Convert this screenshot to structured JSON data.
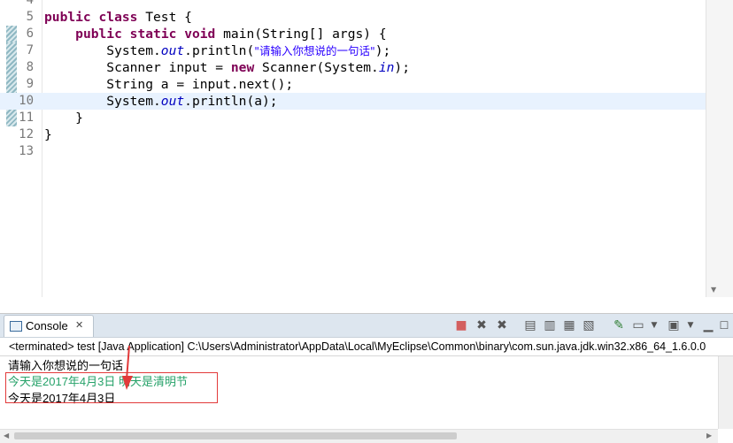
{
  "editor": {
    "lines": [
      {
        "num": "4",
        "segments": []
      },
      {
        "num": "5",
        "segments": [
          {
            "t": "kw",
            "v": "public"
          },
          {
            "t": "",
            "v": " "
          },
          {
            "t": "kw",
            "v": "class"
          },
          {
            "t": "",
            "v": " Test {"
          }
        ]
      },
      {
        "num": "6",
        "segments": [
          {
            "t": "",
            "v": "    "
          },
          {
            "t": "kw",
            "v": "public"
          },
          {
            "t": "",
            "v": " "
          },
          {
            "t": "kw",
            "v": "static"
          },
          {
            "t": "",
            "v": " "
          },
          {
            "t": "kw",
            "v": "void"
          },
          {
            "t": "",
            "v": " main(String[] args) {"
          }
        ]
      },
      {
        "num": "7",
        "segments": [
          {
            "t": "",
            "v": "        System."
          },
          {
            "t": "fld",
            "v": "out"
          },
          {
            "t": "",
            "v": ".println("
          },
          {
            "t": "str",
            "v": "\"请输入你想说的一句话\""
          },
          {
            "t": "",
            "v": ");"
          }
        ]
      },
      {
        "num": "8",
        "segments": [
          {
            "t": "",
            "v": "        Scanner input = "
          },
          {
            "t": "kw",
            "v": "new"
          },
          {
            "t": "",
            "v": " Scanner(System."
          },
          {
            "t": "fld",
            "v": "in"
          },
          {
            "t": "",
            "v": ");"
          }
        ]
      },
      {
        "num": "9",
        "segments": [
          {
            "t": "",
            "v": "        String a = input.next();"
          }
        ]
      },
      {
        "num": "10",
        "segments": [
          {
            "t": "",
            "v": "        System."
          },
          {
            "t": "fld",
            "v": "out"
          },
          {
            "t": "",
            "v": ".println(a);"
          }
        ],
        "current": true
      },
      {
        "num": "11",
        "segments": [
          {
            "t": "",
            "v": "    }"
          }
        ]
      },
      {
        "num": "12",
        "segments": [
          {
            "t": "",
            "v": "}"
          }
        ]
      },
      {
        "num": "13",
        "segments": []
      }
    ],
    "colors": {
      "keyword": "#7f0055",
      "field": "#0000c0",
      "string": "#2a00ff",
      "current_line": "#e8f2fe"
    }
  },
  "console": {
    "tab_label": "Console",
    "tab_icon": "console-icon",
    "status": "<terminated> test [Java Application] C:\\Users\\Administrator\\AppData\\Local\\MyEclipse\\Common\\binary\\com.sun.java.jdk.win32.x86_64_1.6.0.0",
    "output": [
      {
        "text": "请输入你想说的一句话",
        "kind": "stdout"
      },
      {
        "text": "今天是2017年4月3日  明天是清明节",
        "kind": "stdin"
      },
      {
        "text": "今天是2017年4月3日",
        "kind": "stdout"
      }
    ],
    "toolbar_icons": [
      "terminate-icon",
      "remove-launch-icon",
      "remove-all-terminated-icon",
      "clear-console-icon",
      "scroll-lock-icon",
      "word-wrap-icon",
      "show-on-output-icon",
      "show-on-error-icon",
      "pin-console-icon",
      "display-selected-console-icon",
      "open-console-icon",
      "view-menu-icon",
      "minimize-icon",
      "maximize-icon"
    ],
    "colors": {
      "stdin": "#26a269",
      "annotation": "#e23a3a",
      "tabbar": "#dde6ef"
    }
  }
}
